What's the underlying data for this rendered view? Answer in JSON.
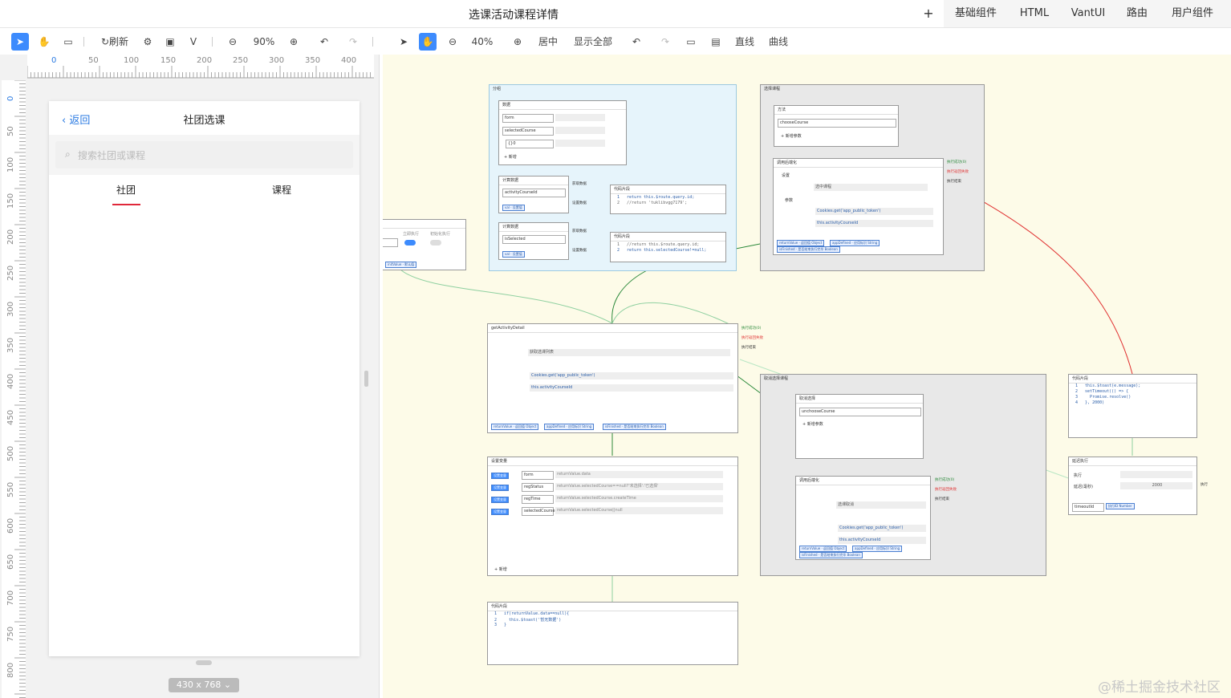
{
  "window": {
    "title": "选课活动课程详情"
  },
  "top_tabs": {
    "plus": "+",
    "items": [
      "基础组件",
      "HTML",
      "VantUI",
      "路由",
      "用户组件"
    ]
  },
  "left_toolbar": {
    "refresh": "刷新",
    "zoom": "90%"
  },
  "right_toolbar": {
    "zoom": "40%",
    "center": "居中",
    "show_all": "显示全部",
    "straight": "直线",
    "curve": "曲线"
  },
  "ruler": {
    "h": [
      "0",
      "50",
      "100",
      "150",
      "200",
      "250",
      "300",
      "350",
      "400"
    ],
    "v": [
      "0",
      "50",
      "100",
      "150",
      "200",
      "250",
      "300",
      "350",
      "400",
      "450",
      "500",
      "550",
      "600",
      "650",
      "700",
      "750",
      "800"
    ]
  },
  "phone": {
    "back": "返回",
    "title": "社团选课",
    "search_placeholder": "搜索社团或课程",
    "tabs": [
      "社团",
      "课程"
    ],
    "size_label": "430 x 768"
  },
  "nodes": {
    "group_left": {
      "title": "分组"
    },
    "data_node": {
      "title": "数据",
      "fields": [
        "form",
        "selectedCourse",
        "{}0"
      ],
      "add": "+ 新增"
    },
    "computed1": {
      "title": "计算数据",
      "field": "activityCourseId",
      "tag": "val · 设置值",
      "out1": "获取数据",
      "out2": "设置数据"
    },
    "code1": {
      "title": "代码片段",
      "lines": [
        "1   return this.$route.query.id;",
        "2   //return 'tuklibvgg7179';"
      ]
    },
    "computed2": {
      "title": "计算数据",
      "field": "isSelected",
      "tag": "val · 设置值",
      "out1": "获取数据",
      "out2": "设置数据"
    },
    "code2": {
      "title": "代码片段",
      "lines": [
        "1   //return this.$route.query.id;",
        "2   return this.selectedCourse!=null;"
      ]
    },
    "group_select": {
      "title": "选择课程"
    },
    "method": {
      "title": "方法",
      "field": "chooseCourse",
      "add": "+ 新增参数"
    },
    "async1": {
      "title": "调用后端化",
      "setting": "设置",
      "method_label": "选中课程",
      "args": "参数",
      "arg1": "Cookies.get('app_public_token')",
      "arg2": "this.activityCourseId",
      "tags": [
        "returnValue · 返回值 Object",
        "appDefined · 应用标识 String",
        "isFinished · 是否结束执行完毕 Boolean"
      ],
      "outs": [
        "执行成功(0)",
        "执行返回失败",
        "执行结束"
      ]
    },
    "switch_node": {
      "labels": [
        "立即执行",
        "初始化执行"
      ],
      "tag": "initValue · 默认值"
    },
    "getDetail": {
      "title": "getActivityDetail",
      "method_label": "获取选课列表",
      "arg1": "Cookies.get('app_public_token')",
      "arg2": "this.activityCourseId",
      "tags": [
        "returnValue · 返回值 Object",
        "appDefined · 应用标识 String",
        "isFinished · 是否结束执行完毕 Boolean"
      ],
      "outs": [
        "执行成功(0)",
        "执行返回失败",
        "执行结束"
      ]
    },
    "setvars": {
      "title": "设置变量",
      "rows": [
        {
          "tag": "设置变量",
          "name": "form",
          "expr": "returnValue.data"
        },
        {
          "tag": "设置变量",
          "name": "regStatus",
          "expr": "returnValue.selectedCourse==null?'未选择':'已选择'"
        },
        {
          "tag": "设置变量",
          "name": "regTime",
          "expr": "returnValue.selectedCourse.createTime"
        },
        {
          "tag": "设置变量",
          "name": "selectedCourse",
          "expr": "returnValue.selectedCourse||null"
        }
      ],
      "add": "+ 新增"
    },
    "code3": {
      "title": "代码片段",
      "lines": [
        "1   if(returnValue.data==null){",
        "2     this.$toast('暂无数据')",
        "3   }"
      ]
    },
    "group_cancel": {
      "title": "取消选择课程"
    },
    "method2": {
      "title": "取消选择",
      "field": "unchooseCourse",
      "add": "+ 新增参数"
    },
    "async2": {
      "title": "调用后端化",
      "method_label": "选课取消",
      "arg1": "Cookies.get('app_public_token')",
      "arg2": "this.activityCourseId",
      "tags": [
        "returnValue · 返回值 Object",
        "appDefined · 应用标识 String",
        "isFinished · 是否结束执行完毕 Boolean"
      ],
      "outs": [
        "执行成功(0)",
        "执行返回失败",
        "执行结束"
      ]
    },
    "code4": {
      "title": "代码片段",
      "lines": [
        "1   this.$toast(e.message);",
        "2   setTimeout(() => {",
        "3     Promise.resolve()",
        "4   }, 2000)"
      ]
    },
    "delay": {
      "title": "延迟执行",
      "labels": [
        "执行",
        "延迟(毫秒)"
      ],
      "value": "2000",
      "tags": [
        "timeoutId",
        "执行ID Number"
      ],
      "out": "执行"
    }
  },
  "watermark": "@稀土掘金技术社区"
}
